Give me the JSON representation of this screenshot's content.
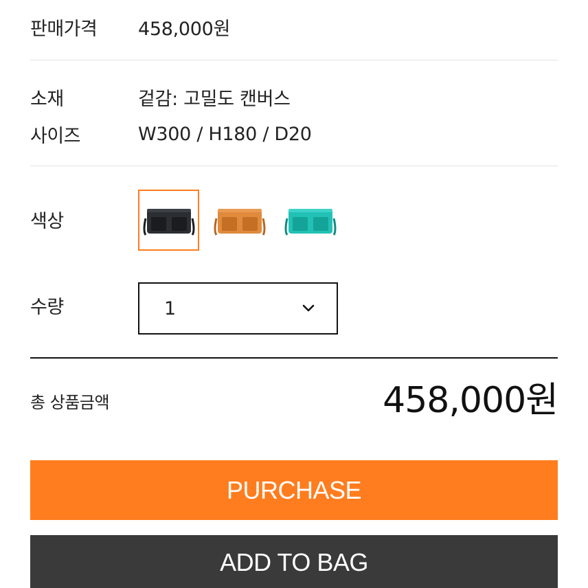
{
  "product": {
    "price_label": "판매가격",
    "price_value": "458,000원",
    "material_label": "소재",
    "material_value": "겉감: 고밀도 캔버스",
    "size_label": "사이즈",
    "size_value": "W300 / H180 / D20"
  },
  "options": {
    "color_label": "색상",
    "colors": [
      {
        "name": "black-bag",
        "hex": "#2b2e33",
        "accent": "#1a1c1f",
        "selected": true
      },
      {
        "name": "orange-bag",
        "hex": "#e08a3c",
        "accent": "#c56f25",
        "selected": false
      },
      {
        "name": "teal-bag",
        "hex": "#22c1b6",
        "accent": "#14a398",
        "selected": false
      }
    ],
    "quantity_label": "수량",
    "quantity_value": "1",
    "chevron_icon": "chevron-down-icon"
  },
  "total": {
    "label": "총 상품금액",
    "amount": "458,000원"
  },
  "actions": {
    "purchase_label": "PURCHASE",
    "add_to_bag_label": "ADD TO BAG"
  },
  "colors": {
    "accent": "#ff7d1e",
    "dark_button": "#3a3a3a"
  }
}
